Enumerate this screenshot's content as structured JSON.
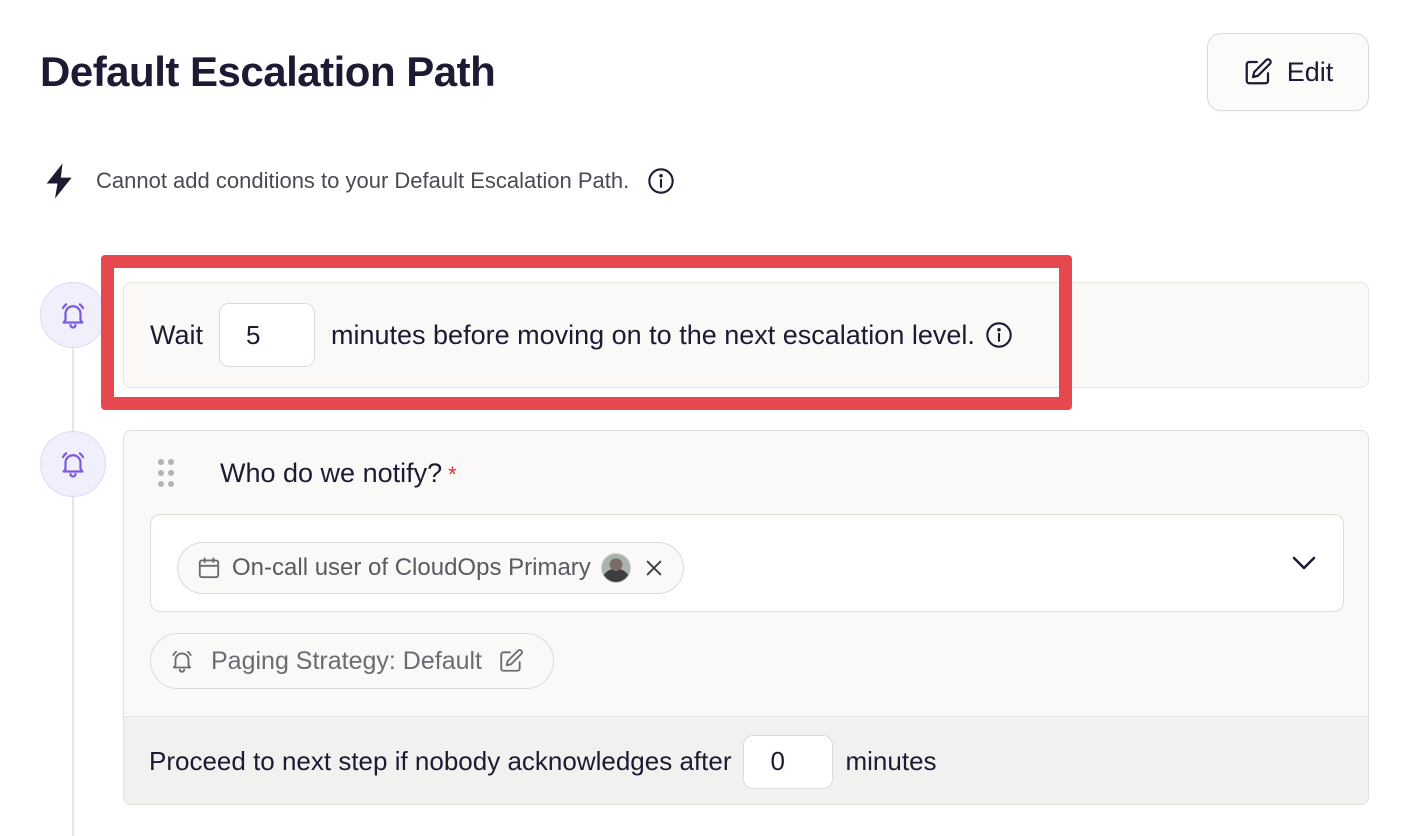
{
  "header": {
    "title": "Default Escalation Path",
    "edit_label": "Edit"
  },
  "notice": {
    "text": "Cannot add conditions to your Default Escalation Path."
  },
  "wait_step": {
    "prefix": "Wait",
    "value": "5",
    "suffix": "minutes before moving on to the next escalation level."
  },
  "notify_step": {
    "title": "Who do we notify?",
    "required_mark": "*",
    "selected_target": "On-call user of CloudOps Primary",
    "paging_strategy": "Paging Strategy: Default",
    "proceed_prefix": "Proceed to next step if nobody acknowledges after",
    "proceed_value": "0",
    "proceed_suffix": "minutes"
  },
  "colors": {
    "highlight": "#e5484d",
    "accent_purple": "#7b5ce0",
    "required": "#d93636"
  },
  "icons": [
    "pencil-icon",
    "lightning-icon",
    "info-icon",
    "bell-icon",
    "calendar-icon",
    "close-icon",
    "chevron-down-icon",
    "drag-handle-icon"
  ]
}
